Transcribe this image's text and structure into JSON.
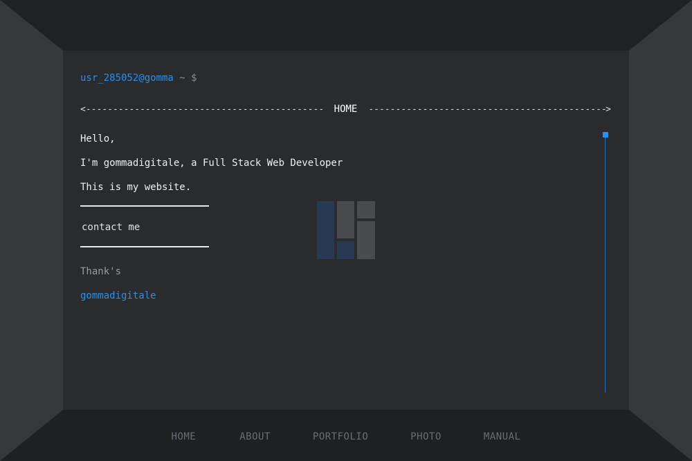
{
  "prompt": {
    "user": "usr_285052@gomma",
    "suffix": " ~ $"
  },
  "nav": {
    "arrow_left": "<",
    "arrow_right": ">",
    "title": "HOME"
  },
  "content": {
    "greeting": "Hello,",
    "intro": "I'm gommadigitale, a Full Stack Web Developer",
    "site": "This is my website.",
    "contact_label": "contact me",
    "thanks": "Thank's",
    "signature": "gommadigitale"
  },
  "menu": {
    "items": [
      "HOME",
      "ABOUT",
      "PORTFOLIO",
      "PHOTO",
      "MANUAL"
    ]
  },
  "colors": {
    "accent": "#2e8fe6",
    "background": "#2a2b2f",
    "frame": "#1f2024",
    "frame_side": "#36373b"
  }
}
